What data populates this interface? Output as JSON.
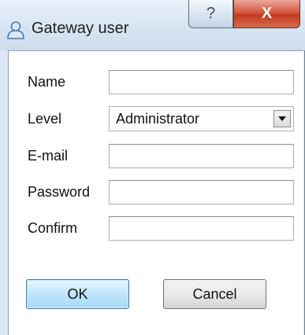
{
  "window": {
    "title": "Gateway user",
    "help_glyph": "?",
    "close_glyph": "X",
    "icon": "user-icon"
  },
  "form": {
    "name_label": "Name",
    "name_value": "",
    "level_label": "Level",
    "level_value": "Administrator",
    "email_label": "E-mail",
    "email_value": "",
    "password_label": "Password",
    "password_value": "",
    "confirm_label": "Confirm",
    "confirm_value": ""
  },
  "buttons": {
    "ok_label": "OK",
    "cancel_label": "Cancel"
  },
  "colors": {
    "frame": "#dbe7f4",
    "close": "#c23a20",
    "ok_border": "#3c7fb1"
  }
}
